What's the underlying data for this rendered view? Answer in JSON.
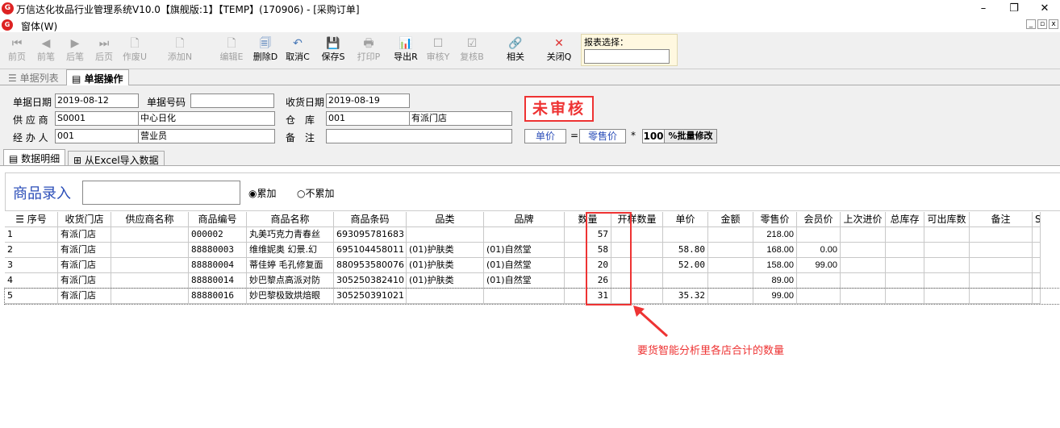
{
  "window": {
    "title": "万信达化妆品行业管理系统V10.0【旗舰版:1】【TEMP】(170906) - [采购订单]",
    "minimize": "–",
    "maximize": "❐",
    "close": "✕"
  },
  "menu": {
    "label": "窗体(W)",
    "mdi": [
      "_",
      "▫",
      "x"
    ]
  },
  "toolbar": [
    {
      "label": "前页",
      "icon": "⏮",
      "enabled": false
    },
    {
      "label": "前笔",
      "icon": "◀",
      "enabled": false
    },
    {
      "label": "后笔",
      "icon": "▶",
      "enabled": false
    },
    {
      "label": "后页",
      "icon": "⏭",
      "enabled": false
    },
    {
      "label": "作废U",
      "icon": "🗋",
      "enabled": false
    },
    {
      "label": "添加N",
      "icon": "🗋",
      "enabled": false
    },
    {
      "label": "编辑E",
      "icon": "🗋",
      "enabled": false
    },
    {
      "label": "删除D",
      "icon": "🗐",
      "enabled": true
    },
    {
      "label": "取消C",
      "icon": "↶",
      "enabled": true
    },
    {
      "label": "保存S",
      "icon": "💾",
      "enabled": true
    },
    {
      "label": "打印P",
      "icon": "🖶",
      "enabled": false
    },
    {
      "label": "导出R",
      "icon": "📊",
      "enabled": true
    },
    {
      "label": "审核Y",
      "icon": "☐",
      "enabled": false
    },
    {
      "label": "复核B",
      "icon": "☑",
      "enabled": false
    },
    {
      "label": "相关",
      "icon": "🔗",
      "enabled": true
    },
    {
      "label": "关闭Q",
      "icon": "✕",
      "enabled": true
    }
  ],
  "report": {
    "label": "报表选择：",
    "value": ""
  },
  "tabs": {
    "list": "单据列表",
    "operation": "单据操作"
  },
  "form": {
    "date_label": "单据日期",
    "date": "2019-08-12",
    "no_label": "单据号码",
    "no": "",
    "recv_label": "收货日期",
    "recv": "2019-08-19",
    "supplier_label": "供 应 商",
    "supplier_code": "S0001",
    "supplier_name": "中心日化",
    "warehouse_label": "仓　库",
    "warehouse_code": "001",
    "warehouse_name": "有派门店",
    "handler_label": "经 办 人",
    "handler_code": "001",
    "handler_name": "营业员",
    "remark_label": "备　注",
    "remark": "",
    "status": "未审核",
    "formula_price": "单价",
    "formula_eq": "=",
    "formula_retail": "零售价",
    "formula_mul": "*",
    "formula_pct": "100",
    "formula_btn": "%批量修改"
  },
  "subtabs": {
    "detail": "数据明细",
    "excel": "从Excel导入数据"
  },
  "entry": {
    "label": "商品录入",
    "value": "",
    "opt1": "累加",
    "opt2": "不累加"
  },
  "columns": [
    "序号",
    "收货门店",
    "供应商名称",
    "商品编号",
    "商品名称",
    "商品条码",
    "品类",
    "品牌",
    "数量",
    "开样数量",
    "单价",
    "金额",
    "零售价",
    "会员价",
    "上次进价",
    "总库存",
    "可出库数",
    "备注",
    "S"
  ],
  "rows": [
    [
      "1",
      "有派门店",
      "",
      "000002",
      "丸美巧克力青春丝",
      "693095781683",
      "",
      "",
      "57",
      "",
      "",
      "",
      "218.00",
      "",
      "",
      "",
      "",
      "",
      ""
    ],
    [
      "2",
      "有派门店",
      "",
      "88880003",
      "维维妮奥 幻景.幻",
      "695104458011",
      "(01)护肤类",
      "(01)自然堂",
      "58",
      "",
      "58.80",
      "",
      "168.00",
      "0.00",
      "",
      "",
      "",
      "",
      ""
    ],
    [
      "3",
      "有派门店",
      "",
      "88880004",
      "蒂佳婷 毛孔修复面",
      "880953580076",
      "(01)护肤类",
      "(01)自然堂",
      "20",
      "",
      "52.00",
      "",
      "158.00",
      "99.00",
      "",
      "",
      "",
      "",
      ""
    ],
    [
      "4",
      "有派门店",
      "",
      "88880014",
      "妙巴黎点高派对防",
      "305250382410",
      "(01)护肤类",
      "(01)自然堂",
      "26",
      "",
      "",
      "",
      "89.00",
      "",
      "",
      "",
      "",
      "",
      ""
    ],
    [
      "5",
      "有派门店",
      "",
      "88880016",
      "妙巴黎极致烘焙眼",
      "305250391021",
      "",
      "",
      "31",
      "",
      "35.32",
      "",
      "99.00",
      "",
      "",
      "",
      "",
      "",
      ""
    ]
  ],
  "annotation": "要货智能分析里各店合计的数量"
}
